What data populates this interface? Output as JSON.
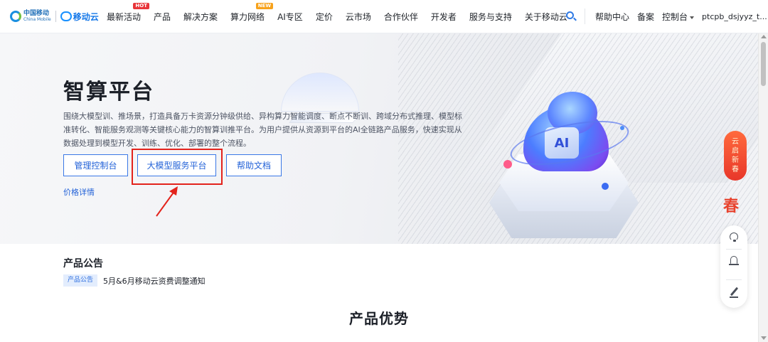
{
  "brand": {
    "china_mobile_cn": "中国移动",
    "china_mobile_en": "China Mobile",
    "ecloud": "移动云"
  },
  "nav": {
    "items": [
      {
        "label": "最新活动",
        "badge": "HOT"
      },
      {
        "label": "产品"
      },
      {
        "label": "解决方案"
      },
      {
        "label": "算力网络",
        "badge": "NEW"
      },
      {
        "label": "AI专区"
      },
      {
        "label": "定价"
      },
      {
        "label": "云市场"
      },
      {
        "label": "合作伙伴"
      },
      {
        "label": "开发者"
      },
      {
        "label": "服务与支持"
      },
      {
        "label": "关于移动云"
      }
    ],
    "help_center": "帮助中心",
    "record": "备案",
    "console": "控制台",
    "username": "ptcpb_dsjyyz_t..."
  },
  "hero": {
    "title": "智算平台",
    "description": "围绕大模型训、推场景，打造具备万卡资源分钟级供给、异构算力智能调度、断点不断训、跨域分布式推理、模型标准转化、智能服务观测等关键核心能力的智算训推平台。为用户提供从资源到平台的AI全链路产品服务，快速实现从数据处理到模型开发、训练、优化、部署的整个流程。",
    "buttons": {
      "console": "管理控制台",
      "llm_platform": "大模型服务平台",
      "docs": "帮助文档"
    },
    "price_link": "价格详情",
    "illustration_chip": "AI"
  },
  "side": {
    "promo_chars": [
      "云",
      "启",
      "新",
      "春"
    ],
    "promo_mark": "春"
  },
  "announcements": {
    "title": "产品公告",
    "items": [
      {
        "tag": "产品公告",
        "text": "5月&6月移动云资费调整通知"
      }
    ]
  },
  "advantages": {
    "title": "产品优势"
  },
  "colors": {
    "primary": "#2463d8",
    "highlight_box": "#e3231c",
    "hot_badge": "#e8353a",
    "new_badge": "#f7a21b"
  }
}
